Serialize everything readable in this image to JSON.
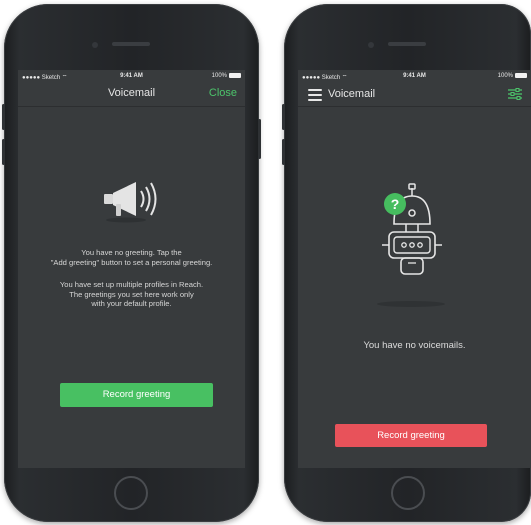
{
  "left_phone": {
    "status_bar": {
      "carrier": "●●●●● Sketch ⌔",
      "time": "9:41 AM",
      "battery": "100%"
    },
    "nav": {
      "title": "Voicemail",
      "close_label": "Close"
    },
    "icon": "megaphone-icon",
    "message_lines": [
      "You have no greeting. Tap the",
      "\"Add greeting\" button to set a personal greeting."
    ],
    "info_lines": [
      "You have set up multiple profiles in Reach.",
      "The greetings you set here work only",
      "with your default profile."
    ],
    "button_label": "Record greeting",
    "button_color": "#48c062"
  },
  "right_phone": {
    "status_bar": {
      "carrier": "●●●●● Sketch ⌔",
      "time": "9:41 AM",
      "battery": "100%"
    },
    "nav": {
      "title": "Voicemail"
    },
    "icons": [
      "hamburger-menu-icon",
      "sliders-icon",
      "robot-icon",
      "question-badge-icon"
    ],
    "question_mark": "?",
    "robot_display": "○○○",
    "message": "You have no voicemails.",
    "button_label": "Record greeting",
    "button_color": "#e8525a"
  },
  "colors": {
    "screen_bg": "#383b3d",
    "accent_green": "#4cc46b",
    "accent_red": "#e8525a"
  }
}
